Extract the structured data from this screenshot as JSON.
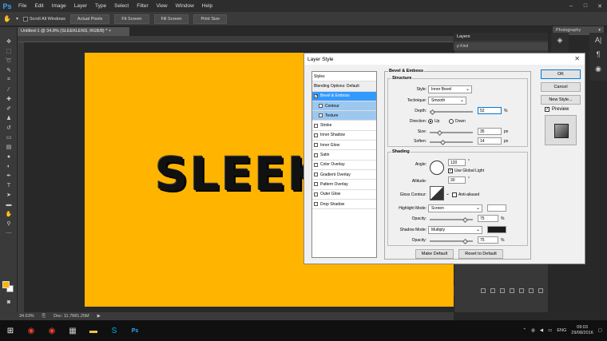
{
  "menubar": {
    "logo": "Ps",
    "items": [
      "File",
      "Edit",
      "Image",
      "Layer",
      "Type",
      "Select",
      "Filter",
      "View",
      "Window",
      "Help"
    ]
  },
  "options": {
    "scroll_all_windows": "Scroll All Windows",
    "actual_pixels": "Actual Pixels",
    "fit_screen": "Fit Screen",
    "fill_screen": "Fill Screen",
    "print_size": "Print Size",
    "workspace": "Photography"
  },
  "document": {
    "tab_title": "Untitled-1 @ 34.8% (SLEEKLENS, RGB/8) *",
    "canvas_text": "SLEEKL",
    "canvas_color": "#ffb400"
  },
  "status": {
    "zoom": "34.63%",
    "doc": "Doc: 11.7M/1.25M"
  },
  "layers": {
    "tab": "Layers",
    "kind": "ρ Kind"
  },
  "dialog": {
    "title": "Layer Style",
    "styles_header": "Styles",
    "styles": [
      {
        "label": "Blending Options: Default",
        "type": "hdr"
      },
      {
        "label": "Bevel & Emboss",
        "type": "active",
        "checked": true
      },
      {
        "label": "Contour",
        "type": "sub"
      },
      {
        "label": "Texture",
        "type": "sub"
      },
      {
        "label": "Stroke",
        "type": "item"
      },
      {
        "label": "Inner Shadow",
        "type": "item"
      },
      {
        "label": "Inner Glow",
        "type": "item"
      },
      {
        "label": "Satin",
        "type": "item"
      },
      {
        "label": "Color Overlay",
        "type": "item"
      },
      {
        "label": "Gradient Overlay",
        "type": "item"
      },
      {
        "label": "Pattern Overlay",
        "type": "item"
      },
      {
        "label": "Outer Glow",
        "type": "item"
      },
      {
        "label": "Drop Shadow",
        "type": "item"
      }
    ],
    "bevel": {
      "title": "Bevel & Emboss",
      "structure_title": "Structure",
      "style_label": "Style:",
      "style_value": "Inner Bevel",
      "technique_label": "Technique:",
      "technique_value": "Smooth",
      "depth_label": "Depth:",
      "depth_value": "52",
      "depth_unit": "%",
      "direction_label": "Direction:",
      "dir_up": "Up",
      "dir_down": "Down",
      "size_label": "Size:",
      "size_value": "35",
      "size_unit": "px",
      "soften_label": "Soften:",
      "soften_value": "14",
      "soften_unit": "px"
    },
    "shading": {
      "title": "Shading",
      "angle_label": "Angle:",
      "angle_value": "120",
      "angle_unit": "°",
      "global_light": "Use Global Light",
      "altitude_label": "Altitude:",
      "altitude_value": "30",
      "altitude_unit": "°",
      "gloss_label": "Gloss Contour:",
      "anti_aliased": "Anti-aliased",
      "highlight_label": "Highlight Mode:",
      "highlight_value": "Screen",
      "highlight_color": "#ffffff",
      "opacity_label": "Opacity:",
      "highlight_opacity": "75",
      "shadow_label": "Shadow Mode:",
      "shadow_value": "Multiply",
      "shadow_color": "#1a1a1a",
      "shadow_opacity": "75",
      "pct": "%"
    },
    "make_default": "Make Default",
    "reset_default": "Reset to Default",
    "ok": "OK",
    "cancel": "Cancel",
    "new_style": "New Style...",
    "preview": "Preview"
  },
  "taskbar": {
    "lang": "ENG",
    "time": "09:03",
    "date": "29/08/2016"
  }
}
